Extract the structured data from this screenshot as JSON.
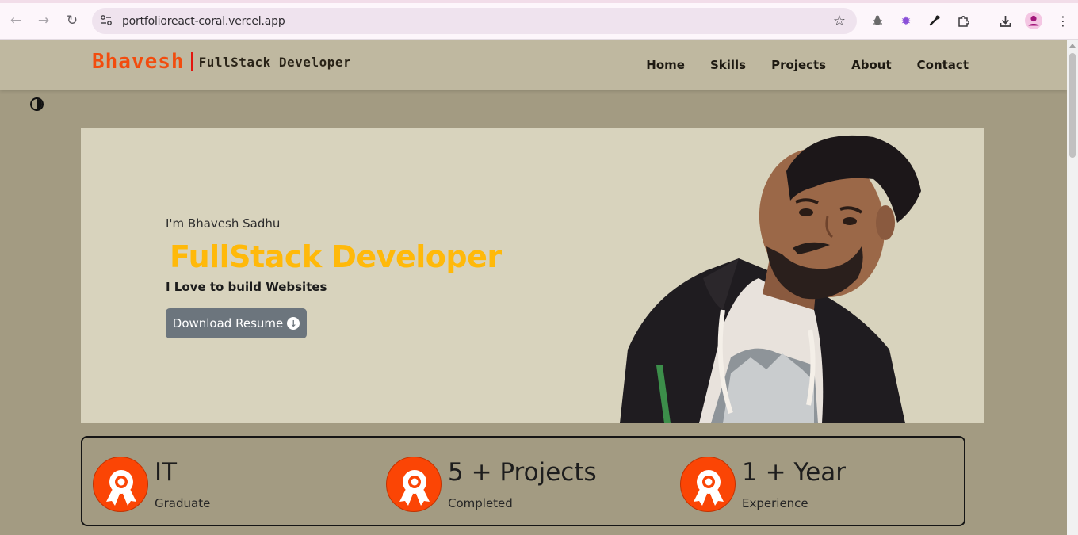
{
  "browser": {
    "url": "portfolioreact-coral.vercel.app",
    "icons": [
      "back-icon",
      "forward-icon",
      "reload-icon",
      "site-info-icon",
      "bookmark-star-icon",
      "bug-extension-icon",
      "gear-extension-icon",
      "eyedropper-icon",
      "extensions-puzzle-icon",
      "download-icon",
      "profile-icon",
      "kebab-menu-icon"
    ]
  },
  "navbar": {
    "brand_name": "Bhavesh",
    "brand_role": "FullStack Developer",
    "links": [
      "Home",
      "Skills",
      "Projects",
      "About",
      "Contact"
    ]
  },
  "theme_toggle_icon": "contrast-half-circle-icon",
  "hero": {
    "intro": "I'm Bhavesh Sadhu",
    "role": "FullStack Developer",
    "tagline": "I Love to build Websites",
    "button_label": "Download Resume",
    "button_icon": "arrow-down-circle-icon"
  },
  "stats": [
    {
      "value": "IT",
      "label": "Graduate",
      "icon": "award-ribbon-icon"
    },
    {
      "value": "5 + Projects",
      "label": "Completed",
      "icon": "award-ribbon-icon"
    },
    {
      "value": "1 + Year",
      "label": "Experience",
      "icon": "award-ribbon-icon"
    }
  ],
  "colors": {
    "page_bg": "#a39b82",
    "navbar_bg": "#bfb8a0",
    "hero_bg": "#d8d3bd",
    "brand_orange": "#f24c0e",
    "role_yellow": "#ffb90a",
    "button_gray": "#6c757d",
    "badge_orange": "#fb4505"
  }
}
